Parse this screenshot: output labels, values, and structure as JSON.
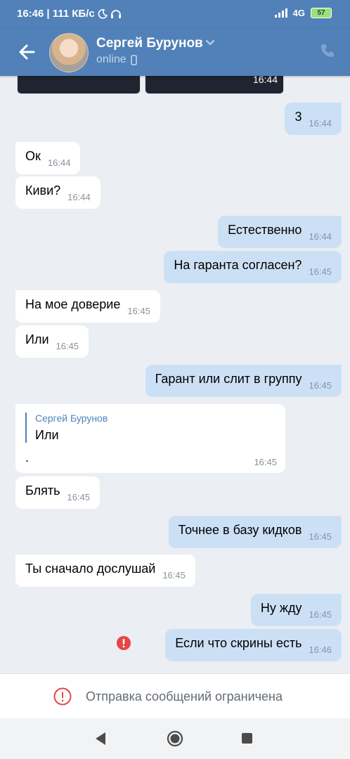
{
  "status_bar": {
    "time": "16:46",
    "speed": "| 111 КБ/с",
    "network": "4G",
    "battery": "57"
  },
  "header": {
    "contact_name": "Сергей Бурунов",
    "presence": "online"
  },
  "image_strip": {
    "time": "16:44"
  },
  "messages": [
    {
      "dir": "out",
      "text": "3",
      "time": "16:44"
    },
    {
      "dir": "in",
      "text": "Ок",
      "time": "16:44"
    },
    {
      "dir": "in",
      "text": "Киви?",
      "time": "16:44"
    },
    {
      "dir": "out",
      "text": "Естественно",
      "time": "16:44"
    },
    {
      "dir": "out",
      "text": "На гаранта согласен?",
      "time": "16:45"
    },
    {
      "dir": "in",
      "text": "На мое доверие",
      "time": "16:45"
    },
    {
      "dir": "in",
      "text": "Или",
      "time": "16:45"
    },
    {
      "dir": "out",
      "text": "Гарант или слит в группу",
      "time": "16:45"
    },
    {
      "dir": "in",
      "text": "Блять",
      "time": "16:45"
    },
    {
      "dir": "out",
      "text": "Точнее в базу кидков",
      "time": "16:45"
    },
    {
      "dir": "in",
      "text": "Ты сначало дослушай",
      "time": "16:45"
    },
    {
      "dir": "out",
      "text": "Ну жду",
      "time": "16:45"
    },
    {
      "dir": "out",
      "text": "Если что скрины есть",
      "time": "16:46"
    }
  ],
  "reply_message": {
    "quoted_author": "Сергей Бурунов",
    "quoted_text": "Или",
    "text": ".",
    "time": "16:45"
  },
  "restricted_notice": "Отправка сообщений ограничена",
  "colors": {
    "header_bg": "#5181b8",
    "chat_bg": "#ebeef2",
    "outgoing_bubble": "#cce0f5",
    "incoming_bubble": "#ffffff",
    "error": "#e64646"
  }
}
